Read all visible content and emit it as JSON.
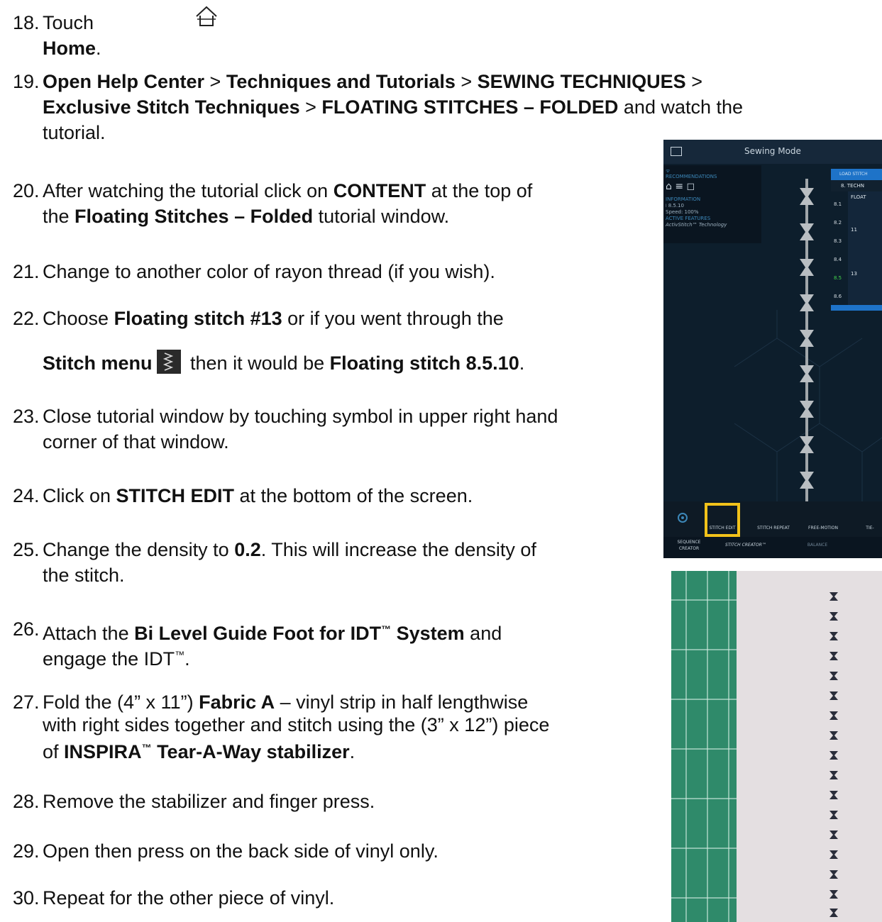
{
  "steps": [
    {
      "num": "18.",
      "parts": [
        [
          "Touch ",
          false
        ],
        [
          "Home",
          true
        ],
        [
          ".",
          false
        ]
      ]
    },
    {
      "num": "19.",
      "lines": [
        [
          [
            "Open Help Center",
            true
          ],
          [
            " > ",
            false
          ],
          [
            "Techniques and Tutorials",
            true
          ],
          [
            " > ",
            false
          ],
          [
            "SEWING TECHNIQUES",
            true
          ],
          [
            " >",
            false
          ]
        ],
        [
          [
            "Exclusive Stitch Techniques",
            true
          ],
          [
            " > ",
            false
          ],
          [
            "FLOATING STITCHES – FOLDED",
            true
          ],
          [
            " and watch the",
            false
          ]
        ],
        [
          [
            "tutorial.",
            false
          ]
        ]
      ]
    },
    {
      "num": "20.",
      "lines": [
        [
          [
            "After watching the tutorial click on ",
            false
          ],
          [
            "CONTENT",
            true
          ],
          [
            " at the top of",
            false
          ]
        ],
        [
          [
            "the ",
            false
          ],
          [
            "Floating Stitches – Folded",
            true
          ],
          [
            " tutorial window.",
            false
          ]
        ]
      ]
    },
    {
      "num": "21.",
      "lines": [
        [
          [
            "Change to another color of rayon thread (if you wish).",
            false
          ]
        ]
      ]
    },
    {
      "num": "22.",
      "lines": [
        [
          [
            "Choose ",
            false
          ],
          [
            "Floating stitch #13",
            true
          ],
          [
            " or if you went through the",
            false
          ]
        ]
      ]
    },
    {
      "num": "23.",
      "lines": [
        [
          [
            "Close tutorial window by touching symbol in upper right hand",
            false
          ]
        ],
        [
          [
            "corner of that window.",
            false
          ]
        ]
      ]
    },
    {
      "num": "24.",
      "lines": [
        [
          [
            "Click on ",
            false
          ],
          [
            "STITCH EDIT",
            true
          ],
          [
            " at the bottom of the screen.",
            false
          ]
        ]
      ]
    },
    {
      "num": "25.",
      "lines": [
        [
          [
            "Change the density to ",
            false
          ],
          [
            "0.2",
            true
          ],
          [
            ". This will increase the density of",
            false
          ]
        ],
        [
          [
            "the stitch.",
            false
          ]
        ]
      ]
    },
    {
      "num": "28.",
      "lines": [
        [
          [
            "Remove the stabilizer and finger press.",
            false
          ]
        ]
      ]
    },
    {
      "num": "29.",
      "lines": [
        [
          [
            "Open then press on the back side of vinyl only.",
            false
          ]
        ]
      ]
    },
    {
      "num": "30.",
      "lines": [
        [
          [
            "Repeat for the other piece of vinyl.",
            false
          ]
        ]
      ]
    }
  ],
  "step22_line2": {
    "a": "Stitch menu",
    "b": " then it would be ",
    "c": "Floating stitch 8.5.10",
    "d": "."
  },
  "step26": {
    "num": "26.",
    "l1a": "Attach the ",
    "l1b": "Bi Level Guide Foot for IDT",
    "tm": "™",
    "l1c": " System",
    "l1d": " and",
    "l2a": "engage the IDT",
    "l2b": "."
  },
  "step27": {
    "num": "27.",
    "l1a": "Fold the (4” x 11”) ",
    "l1b": "Fabric A",
    "l1c": " – vinyl strip in half lengthwise",
    "l2": "with right sides together and stitch using the (3” x 12”) piece",
    "l3a": "of ",
    "l3b": "INSPIRA",
    "tm": "™",
    "l3c": " Tear-A-Way stabilizer",
    "l3d": "."
  },
  "screen": {
    "title": "Sewing Mode",
    "recommendations": "RECOMMENDATIONS",
    "information": "INFORMATION",
    "stitch_no": "8.5.10",
    "speed": "Speed: 100%",
    "active_features": "ACTIVE FEATURES",
    "activstitch": "ActivStitch™ Technology",
    "load_header": "LOAD STITCH",
    "category": "8. TECHN",
    "floating": "FLOAT",
    "rows": [
      "8.1",
      "8.2",
      "8.3",
      "8.4",
      "8.5",
      "8.6"
    ],
    "row_nums": [
      "11",
      "13"
    ],
    "bottom": [
      "STITCH EDIT",
      "STITCH REPEAT",
      "FREE-MOTION",
      "TIE-"
    ],
    "bottom2": [
      "SEQUENCE",
      "CREATOR",
      "STITCH CREATOR™",
      "BALANCE"
    ]
  }
}
